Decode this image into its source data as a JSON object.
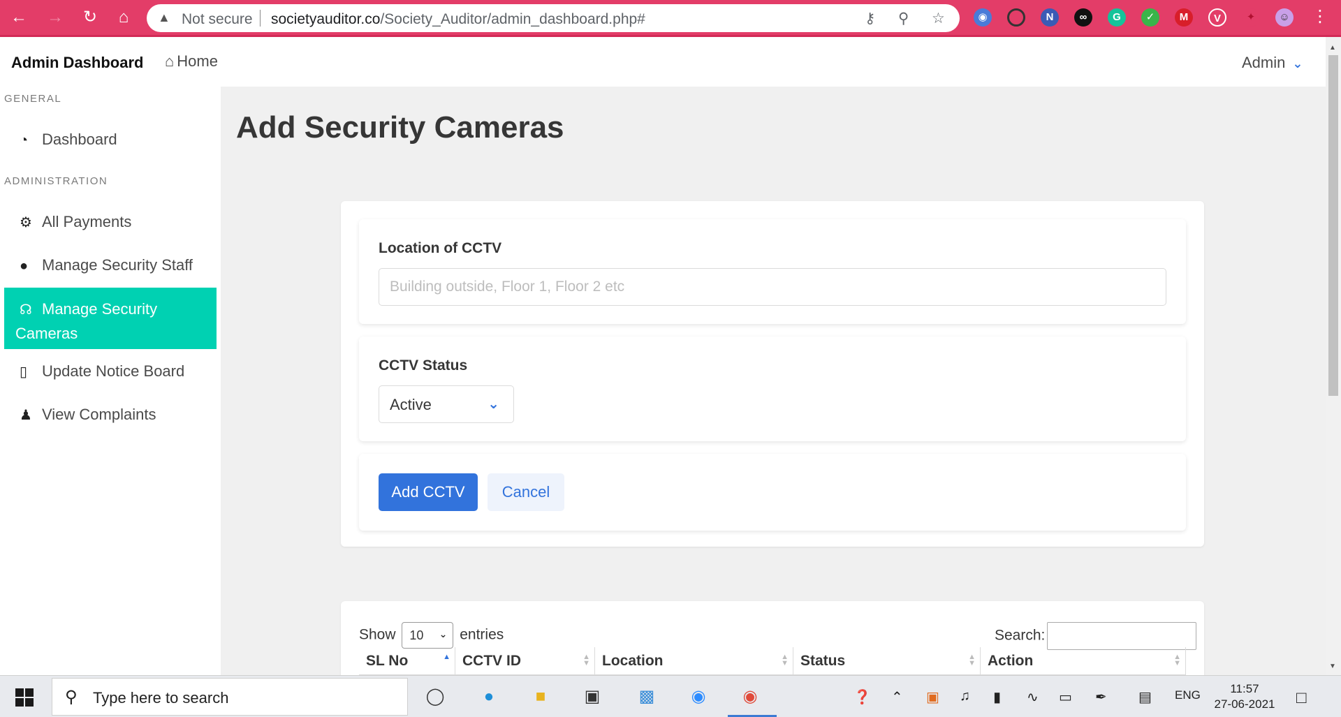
{
  "browser": {
    "not_secure": "Not secure",
    "url_host": "societyauditor.co",
    "url_path": "/Society_Auditor/admin_dashboard.php#"
  },
  "header": {
    "brand": "Admin Dashboard",
    "home": "Home",
    "user": "Admin"
  },
  "sidebar": {
    "general_label": "GENERAL",
    "admin_label": "ADMINISTRATION",
    "items": [
      {
        "label": "Dashboard",
        "icon": "tachometer-icon"
      },
      {
        "label": "All Payments",
        "icon": "gears-icon"
      },
      {
        "label": "Manage Security Staff",
        "icon": "users-icon"
      },
      {
        "label": "Manage Security Cameras",
        "icon": "headset-icon",
        "active": true
      },
      {
        "label": "Update Notice Board",
        "icon": "clipboard-icon"
      },
      {
        "label": "View Complaints",
        "icon": "user-secret-icon"
      }
    ]
  },
  "page": {
    "title": "Add Security Cameras"
  },
  "form": {
    "location_label": "Location of CCTV",
    "location_placeholder": "Building outside, Floor 1, Floor 2 etc",
    "status_label": "CCTV Status",
    "status_value": "Active",
    "submit": "Add CCTV",
    "cancel": "Cancel"
  },
  "table": {
    "show": "Show",
    "entries_value": "10",
    "entries": "entries",
    "search_label": "Search:",
    "columns": [
      "SL No",
      "CCTV ID",
      "Location",
      "Status",
      "Action"
    ]
  },
  "taskbar": {
    "search_placeholder": "Type here to search",
    "lang": "ENG",
    "time": "11:57",
    "date": "27-06-2021"
  },
  "colors": {
    "browser_accent": "#e33d68",
    "active_menu": "#00d1b2",
    "primary": "#3273dc"
  }
}
